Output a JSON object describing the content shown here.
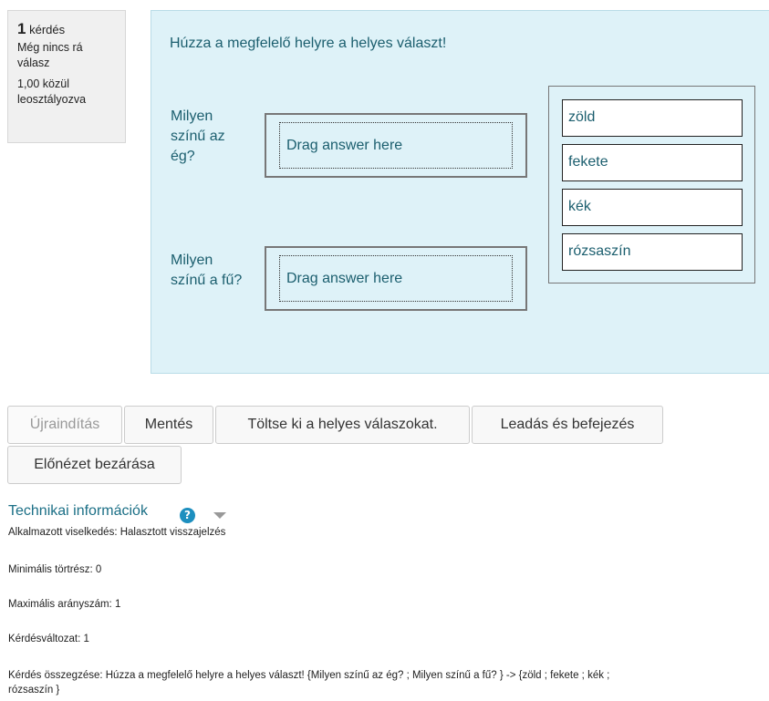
{
  "info": {
    "number": "1",
    "number_suffix": "kérdés",
    "status": "Még nincs rá válasz",
    "mark": "1,00 közül leosztályozva"
  },
  "question": {
    "prompt": "Húzza a megfelelő helyre a helyes választ!",
    "rows": [
      {
        "label_lines": [
          "Milyen",
          "színű az",
          "ég?"
        ],
        "drop_text": "Drag answer here"
      },
      {
        "label_lines": [
          "Milyen",
          "színű a fű?"
        ],
        "drop_text": "Drag answer here"
      }
    ],
    "choices": [
      "zöld",
      "fekete",
      "kék",
      "rózsaszín"
    ]
  },
  "buttons": {
    "restart": "Újraindítás",
    "save": "Mentés",
    "fill_correct": "Töltse ki a helyes válaszokat.",
    "submit": "Leadás és befejezés",
    "close_preview": "Előnézet bezárása"
  },
  "tech": {
    "title": "Technikai információk",
    "help_icon": "question-circle-icon",
    "toggle_icon": "caret-down-icon",
    "behaviour": "Alkalmazott viselkedés: Halasztott visszajelzés",
    "min_fraction": "Minimális törtrész: 0",
    "max_mark": "Maximális arányszám: 1",
    "variant": "Kérdésváltozat: 1",
    "summary_line1": "Kérdés összegzése: Húzza a megfelelő helyre a helyes választ! {Milyen színű az ég? ; Milyen színű a fű? } -> {zöld ; fekete ; kék ;",
    "summary_line2": "rózsaszín }"
  },
  "colors": {
    "question_bg": "#def2f8",
    "text_teal": "#1b5e6e",
    "info_bg": "#f0f0f0",
    "help_blue": "#1d8fbf"
  }
}
